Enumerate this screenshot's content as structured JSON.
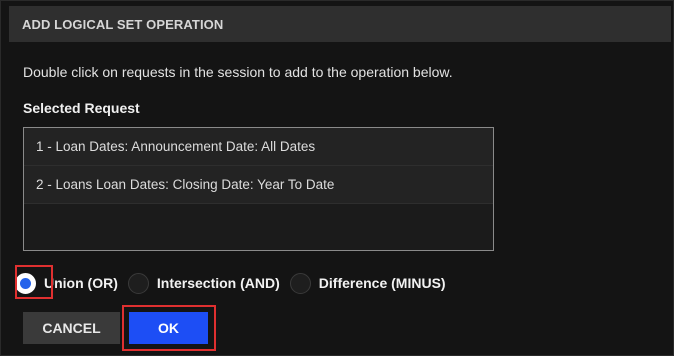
{
  "dialog": {
    "title": "ADD LOGICAL SET OPERATION",
    "instructions": "Double click on requests in the session to add to the operation below.",
    "selected_label": "Selected Request",
    "requests": [
      "1 - Loan Dates: Announcement Date: All Dates",
      "2 - Loans Loan Dates: Closing Date: Year To Date"
    ],
    "operations": [
      {
        "label": "Union (OR)",
        "checked": true
      },
      {
        "label": "Intersection (AND)",
        "checked": false
      },
      {
        "label": "Difference (MINUS)",
        "checked": false
      }
    ],
    "cancel_label": "CANCEL",
    "ok_label": "OK"
  },
  "colors": {
    "accent": "#1d4ef5",
    "highlight": "#e03030"
  }
}
